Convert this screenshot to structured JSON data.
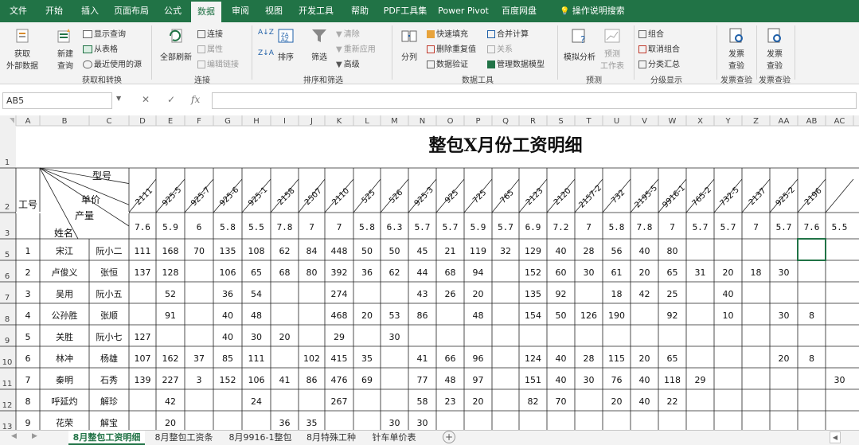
{
  "ribbon_tabs": [
    "文件",
    "开始",
    "插入",
    "页面布局",
    "公式",
    "数据",
    "审阅",
    "视图",
    "开发工具",
    "帮助",
    "PDF工具集",
    "Power Pivot",
    "百度网盘",
    "操作说明搜索"
  ],
  "active_tab": "数据",
  "ribbon": {
    "get_external_line1": "获取",
    "get_external_line2": "外部数据",
    "new_query_line1": "新建",
    "new_query_line2": "查询",
    "show_query": "显示查询",
    "from_table": "从表格",
    "recent_sources": "最近使用的源",
    "group_get_transform": "获取和转换",
    "refresh_all": "全部刷新",
    "connections": "连接",
    "properties": "属性",
    "edit_links": "编辑链接",
    "group_connections": "连接",
    "sort_asc": "A↓Z",
    "sort_desc": "Z↓A",
    "sort": "排序",
    "filter": "筛选",
    "clear": "清除",
    "reapply": "重新应用",
    "advanced": "高级",
    "group_sort_filter": "排序和筛选",
    "split": "分列",
    "flash_fill": "快速填充",
    "remove_duplicates": "删除重复值",
    "data_validation": "数据验证",
    "consolidate": "合并计算",
    "relationships": "关系",
    "manage_data_model": "管理数据模型",
    "group_data_tools": "数据工具",
    "what_if": "模拟分析",
    "forecast_line1": "预测",
    "forecast_line2": "工作表",
    "group_forecast": "预测",
    "group_btn": "组合",
    "ungroup_btn": "取消组合",
    "subtotal": "分类汇总",
    "group_outline": "分级显示",
    "invoice_check_line1": "发票",
    "invoice_check_line2": "查验",
    "group_invoice": "发票查验"
  },
  "name_box": "AB5",
  "fx_label": "fx",
  "columns": [
    "A",
    "B",
    "C",
    "D",
    "E",
    "F",
    "G",
    "H",
    "I",
    "J",
    "K",
    "L",
    "M",
    "N",
    "O",
    "P",
    "Q",
    "R",
    "S",
    "T",
    "U",
    "V",
    "W",
    "X",
    "Y",
    "Z",
    "AA",
    "AB",
    "AC"
  ],
  "sheet": {
    "title": "整包X月份工资明细",
    "header_labels": {
      "model": "型号",
      "price": "单价",
      "output": "产量",
      "name": "姓名",
      "id": "工号"
    },
    "models": [
      "2111",
      "925-5",
      "925-7",
      "925-6",
      "925-1",
      "2158",
      "2507",
      "2110",
      "525",
      "526",
      "925-3",
      "925",
      "725",
      "765",
      "2123",
      "2120",
      "2157-2",
      "732",
      "2195-5",
      "9916-1",
      "765-2",
      "732-5",
      "2137",
      "925-2",
      "2196"
    ],
    "unit_prices": [
      "7.6",
      "5.9",
      "6",
      "5.8",
      "5.5",
      "7.8",
      "7",
      "7",
      "5.8",
      "6.3",
      "5.7",
      "5.7",
      "5.9",
      "5.7",
      "6.9",
      "7.2",
      "7",
      "5.8",
      "7.8",
      "7",
      "5.7",
      "5.7",
      "7",
      "5.7",
      "7.6",
      "5.5"
    ],
    "row_numbers": [
      "1",
      "2",
      "3",
      "5",
      "6",
      "7",
      "8",
      "9",
      "10",
      "11",
      "12",
      "13"
    ],
    "rows": [
      {
        "id": "1",
        "name": "宋江",
        "worker": "阮小二",
        "cells": [
          "111",
          "168",
          "70",
          "135",
          "108",
          "62",
          "84",
          "448",
          "50",
          "50",
          "45",
          "21",
          "119",
          "32",
          "129",
          "40",
          "28",
          "56",
          "40",
          "80",
          "",
          "",
          "",
          "",
          "",
          ""
        ]
      },
      {
        "id": "2",
        "name": "卢俊义",
        "worker": "张恒",
        "cells": [
          "137",
          "128",
          "",
          "106",
          "65",
          "68",
          "80",
          "392",
          "36",
          "62",
          "44",
          "68",
          "94",
          "",
          "152",
          "60",
          "30",
          "61",
          "20",
          "65",
          "31",
          "20",
          "18",
          "30",
          "",
          ""
        ]
      },
      {
        "id": "3",
        "name": "吴用",
        "worker": "阮小五",
        "cells": [
          "",
          "52",
          "",
          "36",
          "54",
          "",
          "",
          "274",
          "",
          "",
          "43",
          "26",
          "20",
          "",
          "135",
          "92",
          "",
          "18",
          "42",
          "25",
          "",
          "40",
          "",
          "",
          "",
          ""
        ]
      },
      {
        "id": "4",
        "name": "公孙胜",
        "worker": "张顺",
        "cells": [
          "",
          "91",
          "",
          "40",
          "48",
          "",
          "",
          "468",
          "20",
          "53",
          "86",
          "",
          "48",
          "",
          "154",
          "50",
          "126",
          "190",
          "",
          "92",
          "",
          "10",
          "",
          "30",
          "8",
          ""
        ]
      },
      {
        "id": "5",
        "name": "关胜",
        "worker": "阮小七",
        "cells": [
          "127",
          "",
          "",
          "40",
          "30",
          "20",
          "",
          "29",
          "",
          "30",
          "",
          "",
          "",
          "",
          "",
          "",
          "",
          "",
          "",
          "",
          "",
          "",
          "",
          "",
          "",
          ""
        ]
      },
      {
        "id": "6",
        "name": "林冲",
        "worker": "杨雄",
        "cells": [
          "107",
          "162",
          "37",
          "85",
          "111",
          "",
          "102",
          "415",
          "35",
          "",
          "41",
          "66",
          "96",
          "",
          "124",
          "40",
          "28",
          "115",
          "20",
          "65",
          "",
          "",
          "",
          "20",
          "8",
          ""
        ]
      },
      {
        "id": "7",
        "name": "秦明",
        "worker": "石秀",
        "cells": [
          "139",
          "227",
          "3",
          "152",
          "106",
          "41",
          "86",
          "476",
          "69",
          "",
          "77",
          "48",
          "97",
          "",
          "151",
          "40",
          "30",
          "76",
          "40",
          "118",
          "29",
          "",
          "",
          "",
          "",
          "30"
        ]
      },
      {
        "id": "8",
        "name": "呼延灼",
        "worker": "解珍",
        "cells": [
          "",
          "42",
          "",
          "",
          "24",
          "",
          "",
          "267",
          "",
          "",
          "58",
          "23",
          "20",
          "",
          "82",
          "70",
          "",
          "20",
          "40",
          "22",
          "",
          "",
          "",
          "",
          "",
          ""
        ]
      },
      {
        "id": "9",
        "name": "花荣",
        "worker": "解宝",
        "cells": [
          "",
          "20",
          "",
          "",
          "",
          "36",
          "35",
          "",
          "",
          "30",
          "30",
          "",
          "",
          "",
          "",
          "",
          "",
          "",
          "",
          "",
          "",
          "",
          "",
          "",
          "",
          ""
        ]
      }
    ]
  },
  "sheet_tabs": [
    "8月整包工资明细",
    "8月整包工资条",
    "8月9916-1整包",
    "8月特殊工种",
    "针车单价表"
  ],
  "active_sheet": "8月整包工资明细",
  "add_sheet": "+"
}
